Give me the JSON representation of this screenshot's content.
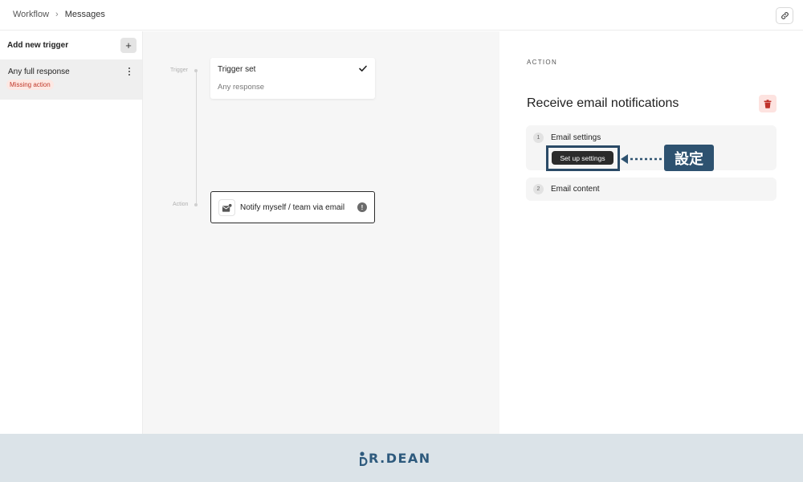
{
  "breadcrumb": {
    "root": "Workflow",
    "separator": "›",
    "current": "Messages"
  },
  "sidebar": {
    "heading": "Add new trigger",
    "add_label": "+",
    "items": [
      {
        "title": "Any full response",
        "badge": "Missing action"
      }
    ]
  },
  "canvas": {
    "labels": {
      "trigger": "Trigger",
      "action": "Action"
    },
    "trigger_card": {
      "title": "Trigger set",
      "subtitle": "Any response"
    },
    "action_card": {
      "label": "Notify myself / team via email",
      "warning": "!"
    }
  },
  "panel": {
    "eyebrow": "ACTION",
    "title": "Receive email notifications",
    "steps": [
      {
        "number": "1",
        "label": "Email settings",
        "button": "Set up settings"
      },
      {
        "number": "2",
        "label": "Email content"
      }
    ]
  },
  "annotation": {
    "text": "設定",
    "color": "#2e5270"
  },
  "footer": {
    "logo_text": "R.DEAN",
    "color": "#2e5a7d"
  },
  "icons": {
    "link": "link-icon",
    "check": "check-icon",
    "email": "email-icon",
    "trash": "trash-icon",
    "more": "kebab-icon"
  }
}
